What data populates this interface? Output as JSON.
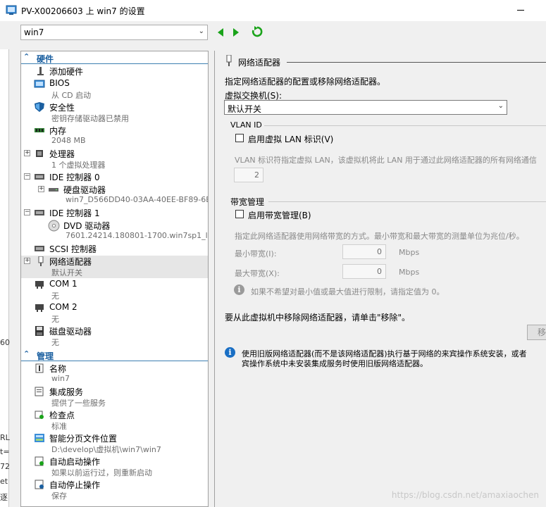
{
  "window": {
    "title": "PV-X00206603 上 win7 的设置"
  },
  "toolbar": {
    "vm_selected": "win7"
  },
  "edge": {
    "labels": [
      "60",
      "RL",
      "t=",
      "72",
      "et",
      "逐"
    ]
  },
  "tree": {
    "hardware_header": "硬件",
    "management_header": "管理",
    "items": [
      {
        "name": "添加硬件",
        "sub": ""
      },
      {
        "name": "BIOS",
        "sub": "从 CD 启动"
      },
      {
        "name": "安全性",
        "sub": "密钥存储驱动器已禁用"
      },
      {
        "name": "内存",
        "sub": "2048 MB"
      },
      {
        "name": "处理器",
        "sub": "1 个虚拟处理器"
      },
      {
        "name": "IDE 控制器 0",
        "sub": ""
      },
      {
        "name": "硬盘驱动器",
        "sub": "win7_D566DD40-03AA-40EE-BF89-6B..."
      },
      {
        "name": "IDE 控制器 1",
        "sub": ""
      },
      {
        "name": "DVD 驱动器",
        "sub": "7601.24214.180801-1700.win7sp1_ld..."
      },
      {
        "name": "SCSI 控制器",
        "sub": ""
      },
      {
        "name": "网络适配器",
        "sub": "默认开关"
      },
      {
        "name": "COM 1",
        "sub": "无"
      },
      {
        "name": "COM 2",
        "sub": "无"
      },
      {
        "name": "磁盘驱动器",
        "sub": "无"
      }
    ],
    "mgmt_items": [
      {
        "name": "名称",
        "sub": "win7"
      },
      {
        "name": "集成服务",
        "sub": "提供了一些服务"
      },
      {
        "name": "检查点",
        "sub": "标准"
      },
      {
        "name": "智能分页文件位置",
        "sub": "D:\\develop\\虚拟机\\win7\\win7"
      },
      {
        "name": "自动启动操作",
        "sub": "如果以前运行过，则重新启动"
      },
      {
        "name": "自动停止操作",
        "sub": "保存"
      }
    ]
  },
  "panel": {
    "heading": "网络适配器",
    "description": "指定网络适配器的配置或移除网络适配器。",
    "switch_label": "虚拟交换机(S):",
    "switch_value": "默认开关",
    "vlan_group": "VLAN ID",
    "vlan_checkbox": "启用虚拟 LAN 标识(V)",
    "vlan_help": "VLAN 标识符指定虚拟 LAN，该虚拟机将此 LAN 用于通过此网络适配器的所有网络通信",
    "vlan_value": "2",
    "bw_group": "带宽管理",
    "bw_checkbox": "启用带宽管理(B)",
    "bw_help": "指定此网络适配器使用网络带宽的方式。最小带宽和最大带宽的测量单位为兆位/秒。",
    "min_label": "最小带宽(I):",
    "min_value": "0",
    "max_label": "最大带宽(X):",
    "max_value": "0",
    "unit": "Mbps",
    "limit_info": "如果不希望对最小值或最大值进行限制，请指定值为 0。",
    "remove_text": "要从此虚拟机中移除网络适配器，请单击\"移除\"。",
    "remove_button": "移",
    "legacy_info_1": "使用旧版网络适配器(而不是该网络适配器)执行基于网络的来宾操作系统安装，或者",
    "legacy_info_2": "宾操作系统中未安装集成服务时使用旧版网络适配器。"
  },
  "watermark": "https://blog.csdn.net/amaxiaochen",
  "colors": {
    "accent": "#1a5fa0",
    "info_blue": "#1a6fc4",
    "nav_green": "#1aa31a"
  }
}
